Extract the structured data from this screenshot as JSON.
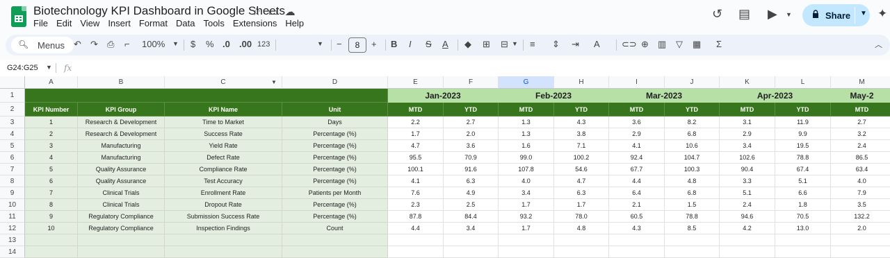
{
  "app": {
    "doc_title": "Biotechnology KPI Dashboard in Google Sheets",
    "menu": [
      "File",
      "Edit",
      "View",
      "Insert",
      "Format",
      "Data",
      "Tools",
      "Extensions",
      "Help"
    ],
    "share_label": "Share",
    "title_icons": [
      "star-icon",
      "move-folder-icon",
      "cloud-status-icon"
    ],
    "right_icons": [
      "history-icon",
      "comment-icon",
      "meet-icon",
      "gemini-icon"
    ]
  },
  "toolbar": {
    "menus_label": "Menus",
    "zoom": "100%",
    "currency": "$",
    "percent": "%",
    "dec_decrease": ".0",
    "dec_increase": ".00",
    "number_format": "123",
    "font_size": "8"
  },
  "formula_bar": {
    "name_box": "G24:G25",
    "fx": "fx"
  },
  "columns": [
    "A",
    "B",
    "C",
    "D",
    "E",
    "F",
    "G",
    "H",
    "I",
    "J",
    "K",
    "L",
    "M"
  ],
  "selected_column": "G",
  "rows": [
    "1",
    "2",
    "3",
    "4",
    "5",
    "6",
    "7",
    "8",
    "9",
    "10",
    "11",
    "12",
    "13",
    "14"
  ],
  "headers": {
    "kpi_number": "KPI Number",
    "kpi_group": "KPI Group",
    "kpi_name": "KPI Name",
    "unit": "Unit",
    "months": [
      "Jan-2023",
      "Feb-2023",
      "Mar-2023",
      "Apr-2023",
      "May-2"
    ],
    "mtd": "MTD",
    "ytd": "YTD"
  },
  "kpis": [
    {
      "num": "1",
      "group": "Research & Development",
      "name": "Time to Market",
      "unit": "Days",
      "vals": [
        "2.2",
        "2.7",
        "1.3",
        "4.3",
        "3.6",
        "8.2",
        "3.1",
        "11.9",
        "2.7"
      ]
    },
    {
      "num": "2",
      "group": "Research & Development",
      "name": "Success Rate",
      "unit": "Percentage (%)",
      "vals": [
        "1.7",
        "2.0",
        "1.3",
        "3.8",
        "2.9",
        "6.8",
        "2.9",
        "9.9",
        "3.2"
      ]
    },
    {
      "num": "3",
      "group": "Manufacturing",
      "name": "Yield Rate",
      "unit": "Percentage (%)",
      "vals": [
        "4.7",
        "3.6",
        "1.6",
        "7.1",
        "4.1",
        "10.6",
        "3.4",
        "19.5",
        "2.4"
      ]
    },
    {
      "num": "4",
      "group": "Manufacturing",
      "name": "Defect Rate",
      "unit": "Percentage (%)",
      "vals": [
        "95.5",
        "70.9",
        "99.0",
        "100.2",
        "92.4",
        "104.7",
        "102.6",
        "78.8",
        "86.5"
      ]
    },
    {
      "num": "5",
      "group": "Quality Assurance",
      "name": "Compliance Rate",
      "unit": "Percentage (%)",
      "vals": [
        "100.1",
        "91.6",
        "107.8",
        "54.6",
        "67.7",
        "100.3",
        "90.4",
        "67.4",
        "63.4"
      ]
    },
    {
      "num": "6",
      "group": "Quality Assurance",
      "name": "Test Accuracy",
      "unit": "Percentage (%)",
      "vals": [
        "4.1",
        "6.3",
        "4.0",
        "4.7",
        "4.4",
        "4.8",
        "3.3",
        "5.1",
        "4.0"
      ]
    },
    {
      "num": "7",
      "group": "Clinical Trials",
      "name": "Enrollment Rate",
      "unit": "Patients per Month",
      "vals": [
        "7.6",
        "4.9",
        "3.4",
        "6.3",
        "6.4",
        "6.8",
        "5.1",
        "6.6",
        "7.9"
      ]
    },
    {
      "num": "8",
      "group": "Clinical Trials",
      "name": "Dropout Rate",
      "unit": "Percentage (%)",
      "vals": [
        "2.3",
        "2.5",
        "1.7",
        "1.7",
        "2.1",
        "1.5",
        "2.4",
        "1.8",
        "3.5"
      ]
    },
    {
      "num": "9",
      "group": "Regulatory Compliance",
      "name": "Submission Success Rate",
      "unit": "Percentage (%)",
      "vals": [
        "87.8",
        "84.4",
        "93.2",
        "78.0",
        "60.5",
        "78.8",
        "94.6",
        "70.5",
        "132.2"
      ]
    },
    {
      "num": "10",
      "group": "Regulatory Compliance",
      "name": "Inspection Findings",
      "unit": "Count",
      "vals": [
        "4.4",
        "3.4",
        "1.7",
        "4.8",
        "4.3",
        "8.5",
        "4.2",
        "13.0",
        "2.0"
      ]
    }
  ],
  "colors": {
    "header_dark": "#38761d",
    "header_light": "#b6e0a6",
    "left_fill": "#e3eee0",
    "share": "#c2e7ff"
  }
}
